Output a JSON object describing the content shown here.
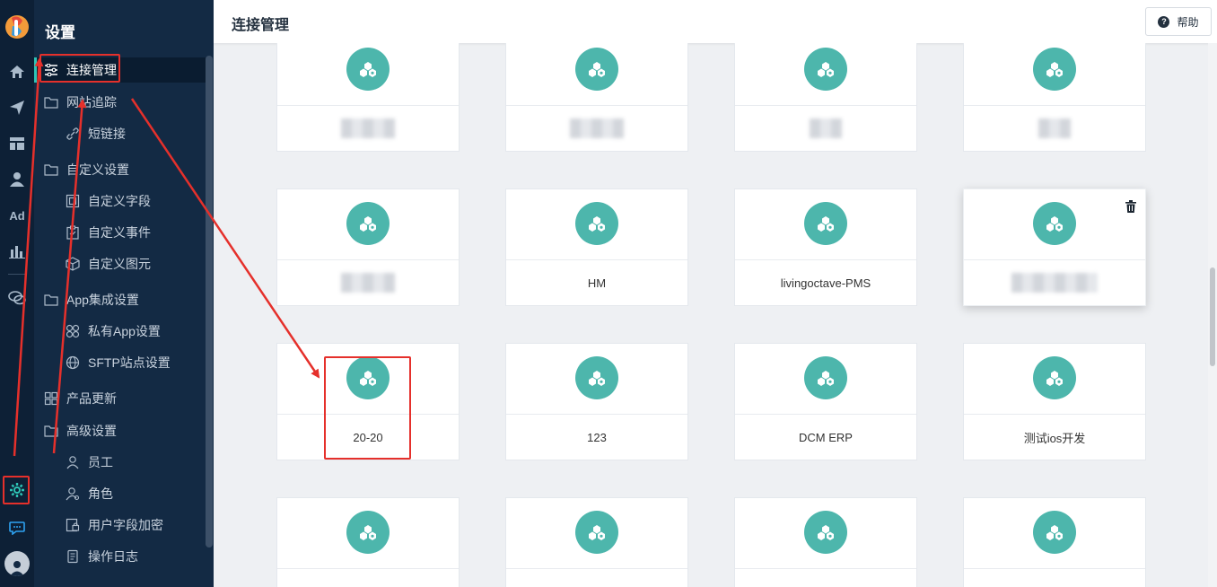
{
  "sidebar": {
    "title": "设置",
    "items": [
      {
        "label": "连接管理",
        "icon": "sliders-icon",
        "active": true
      },
      {
        "label": "网站追踪",
        "icon": "folder-icon"
      },
      {
        "label": "短链接",
        "icon": "link-icon"
      },
      {
        "label": "自定义设置",
        "icon": "folder-icon"
      },
      {
        "label": "自定义字段",
        "icon": "field-icon"
      },
      {
        "label": "自定义事件",
        "icon": "event-icon"
      },
      {
        "label": "自定义图元",
        "icon": "cube-icon"
      },
      {
        "label": "App集成设置",
        "icon": "folder-icon"
      },
      {
        "label": "私有App设置",
        "icon": "apps-icon"
      },
      {
        "label": "SFTP站点设置",
        "icon": "globe-icon"
      },
      {
        "label": "产品更新",
        "icon": "grid-icon"
      },
      {
        "label": "高级设置",
        "icon": "folder-icon"
      },
      {
        "label": "员工",
        "icon": "user-icon"
      },
      {
        "label": "角色",
        "icon": "role-icon"
      },
      {
        "label": "用户字段加密",
        "icon": "encrypt-icon"
      },
      {
        "label": "操作日志",
        "icon": "log-icon"
      }
    ]
  },
  "rail": {
    "ad_label": "Ad",
    "icons": [
      "home-icon",
      "send-icon",
      "layout-icon",
      "user-icon",
      "ad-icon",
      "chart-icon",
      "chat-icon",
      "settings-icon",
      "message-icon",
      "avatar-icon"
    ]
  },
  "header": {
    "title": "连接管理",
    "help_label": "帮助"
  },
  "connections": [
    {
      "name": "",
      "blurred": true
    },
    {
      "name": "",
      "blurred": true
    },
    {
      "name": "",
      "blurred": true
    },
    {
      "name": "",
      "blurred": true
    },
    {
      "name": "",
      "blurred": true
    },
    {
      "name": "HM"
    },
    {
      "name": "livingoctave-PMS"
    },
    {
      "name": "",
      "blurred": true,
      "hovered": true
    },
    {
      "name": "20-20",
      "highlighted": true
    },
    {
      "name": "123"
    },
    {
      "name": "DCM ERP"
    },
    {
      "name": "测试ios开发"
    },
    {
      "name": ""
    },
    {
      "name": ""
    },
    {
      "name": ""
    },
    {
      "name": ""
    }
  ],
  "colors": {
    "accent": "#4db6ac",
    "annotation": "#e5302b",
    "sidebar_bg": "#132a44",
    "rail_bg": "#0d2036"
  }
}
